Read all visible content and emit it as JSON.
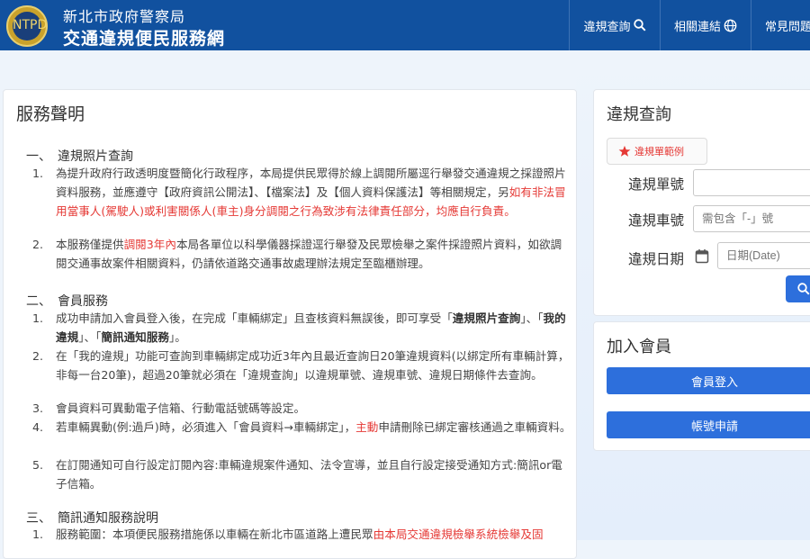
{
  "header": {
    "org": "新北市政府警察局",
    "site": "交通違規便民服務網",
    "logo_text": "NTPD",
    "nav": [
      {
        "label": "違規查詢",
        "icon": "search-icon"
      },
      {
        "label": "相關連結",
        "icon": "globe-icon"
      },
      {
        "label": "常見問題",
        "icon": ""
      }
    ]
  },
  "main": {
    "title": "服務聲明",
    "sections": [
      {
        "title": "一、　違規照片查詢",
        "items": [
          {
            "num": "1.",
            "text": "為提升政府行政透明度暨簡化行政程序，本局提供民眾得於線上調閱所屬逕行舉發交通違規之採證照片資料服務，並應遵守【政府資訊公開法】、【檔案法】及【個人資料保護法】等相關規定，另",
            "red": "如有非法冒用當事人(駕駛人)或利害關係人(車主)身分調閱之行為致涉有法律責任部分，均應自行負責。",
            "after": ""
          },
          {
            "num": "2.",
            "text": "本服務僅提供",
            "red": "調閱3年內",
            "after": "本局各單位以科學儀器採證逕行舉發及民眾檢舉之案件採證照片資料，如欲調閱交通事故案件相關資料，仍請依道路交通事故處理辦法規定至臨櫃辦理。"
          }
        ]
      },
      {
        "title": "二、　會員服務",
        "items": [
          {
            "num": "1.",
            "text": "成功申請加入會員登入後，在完成「車輛綁定」且查核資料無誤後，即可享受「",
            "bold1": "違規照片查詢",
            "mid": "」、「",
            "bold2": "我的違規",
            "mid2": "」、「",
            "bold3": "簡訊通知服務",
            "after": "」。"
          },
          {
            "num": "2.",
            "text": "在「我的違規」功能可查詢到車輛綁定成功近3年內且最近查詢日20筆違規資料(以綁定所有車輛計算，非每一台20筆)，超過20筆就必須在「違規查詢」以違規單號、違規車號、違規日期條件去查詢。"
          },
          {
            "num": "3.",
            "text": "會員資料可異動電子信箱、行動電話號碼等設定。"
          },
          {
            "num": "4.",
            "text": "若車輛異動(例:過戶)時，必須進入「會員資料→車輛綁定」，",
            "red": "主動",
            "after": "申請刪除已綁定審核通過之車輛資料。"
          },
          {
            "num": "5.",
            "text": "在訂閱通知可自行設定訂閱內容:車輛違規案件通知、法令宣導，並且自行設定接受通知方式:簡訊or電子信箱。"
          }
        ]
      },
      {
        "title": "三、　簡訊通知服務說明",
        "items": [
          {
            "num": "1.",
            "text": "服務範圍：本項便民服務措施係以車輛在新北市區道路上遭民眾",
            "red": "由本局交通違規檢舉系統檢舉及固"
          }
        ]
      }
    ]
  },
  "query": {
    "title": "違規查詢",
    "example_label": "違規單範例",
    "fields": [
      {
        "label": "違規單號",
        "placeholder": ""
      },
      {
        "label": "違規車號",
        "placeholder": "需包含「-」號"
      },
      {
        "label": "違規日期",
        "placeholder": "日期(Date)"
      }
    ]
  },
  "member": {
    "title": "加入會員",
    "login_label": "會員登入",
    "register_label": "帳號申請"
  },
  "colors": {
    "header": "#11519f",
    "accent": "#2d6fdc",
    "warn": "#e53935"
  }
}
